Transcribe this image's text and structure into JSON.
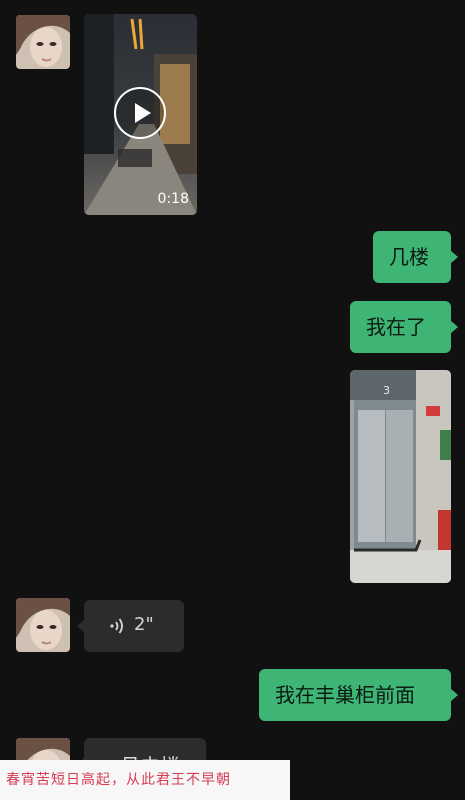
{
  "messages": {
    "video_duration": "0:18",
    "text_1": "几楼",
    "text_2": "我在了",
    "voice_duration": "2\"",
    "text_3": "我在丰巢柜前面",
    "text_4_partial": "一月去楼"
  },
  "overlay": {
    "caption": "春宵苦短日高起，从此君王不早朝"
  },
  "colors": {
    "background": "#111111",
    "outgoing_bubble": "#3eb575",
    "incoming_bubble": "#2c2c2c",
    "caption_text": "#d43c52"
  }
}
